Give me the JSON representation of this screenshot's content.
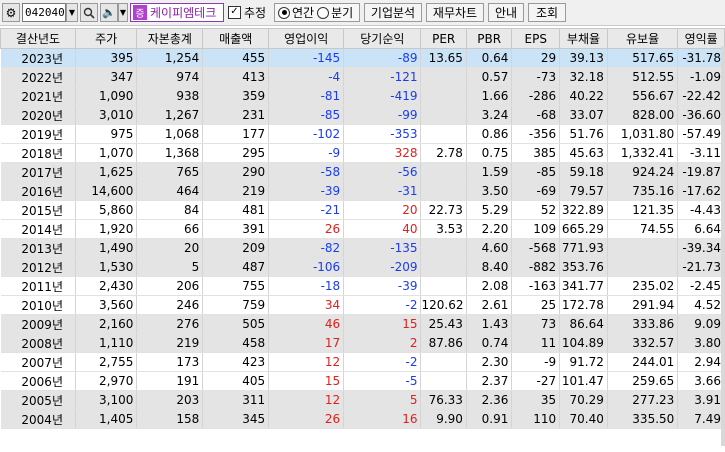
{
  "toolbar": {
    "gear_icon": "gear-icon",
    "code": "042040",
    "search_icon": "magnifier-icon",
    "speaker_icon": "speaker-icon",
    "badge_char": "증",
    "company": "케이피엠테크",
    "trend_label": "추정",
    "trend_checked": true,
    "period_yearly": "연간",
    "period_quarterly": "분기",
    "period_selected": "yearly",
    "btn_company": "기업분석",
    "btn_chart": "재무차트",
    "btn_guide": "안내",
    "btn_query": "조회"
  },
  "table": {
    "columns": [
      "결산년도",
      "주가",
      "자본총계",
      "매출액",
      "영업이익",
      "당기순익",
      "PER",
      "PBR",
      "EPS",
      "부채율",
      "유보율",
      "영익률"
    ],
    "rows": [
      [
        "2023년",
        "395",
        "1,254",
        "455",
        "-145",
        "-89",
        "13.65",
        "0.64",
        "29",
        "39.13",
        "517.65",
        "-31.78"
      ],
      [
        "2022년",
        "347",
        "974",
        "413",
        "-4",
        "-121",
        "",
        "0.57",
        "-73",
        "32.18",
        "512.55",
        "-1.09"
      ],
      [
        "2021년",
        "1,090",
        "938",
        "359",
        "-81",
        "-419",
        "",
        "1.66",
        "-286",
        "40.22",
        "556.67",
        "-22.42"
      ],
      [
        "2020년",
        "3,010",
        "1,267",
        "231",
        "-85",
        "-99",
        "",
        "3.24",
        "-68",
        "33.07",
        "828.00",
        "-36.60"
      ],
      [
        "2019년",
        "975",
        "1,068",
        "177",
        "-102",
        "-353",
        "",
        "0.86",
        "-356",
        "51.76",
        "1,031.80",
        "-57.49"
      ],
      [
        "2018년",
        "1,070",
        "1,368",
        "295",
        "-9",
        "328",
        "2.78",
        "0.75",
        "385",
        "45.63",
        "1,332.41",
        "-3.11"
      ],
      [
        "2017년",
        "1,625",
        "765",
        "290",
        "-58",
        "-56",
        "",
        "1.59",
        "-85",
        "59.18",
        "924.24",
        "-19.87"
      ],
      [
        "2016년",
        "14,600",
        "464",
        "219",
        "-39",
        "-31",
        "",
        "3.50",
        "-69",
        "79.57",
        "735.16",
        "-17.62"
      ],
      [
        "2015년",
        "5,860",
        "84",
        "481",
        "-21",
        "20",
        "22.73",
        "5.29",
        "52",
        "322.89",
        "121.35",
        "-4.43"
      ],
      [
        "2014년",
        "1,920",
        "66",
        "391",
        "26",
        "40",
        "3.53",
        "2.20",
        "109",
        "665.29",
        "74.55",
        "6.64"
      ],
      [
        "2013년",
        "1,490",
        "20",
        "209",
        "-82",
        "-135",
        "",
        "4.60",
        "-568",
        "771.93",
        "",
        "-39.34"
      ],
      [
        "2012년",
        "1,530",
        "5",
        "487",
        "-106",
        "-209",
        "",
        "8.40",
        "-882",
        "353.76",
        "",
        "-21.73"
      ],
      [
        "2011년",
        "2,430",
        "206",
        "755",
        "-18",
        "-39",
        "",
        "2.08",
        "-163",
        "341.77",
        "235.02",
        "-2.45"
      ],
      [
        "2010년",
        "3,560",
        "246",
        "759",
        "34",
        "-2",
        "120.62",
        "2.61",
        "25",
        "172.78",
        "291.94",
        "4.52"
      ],
      [
        "2009년",
        "2,160",
        "276",
        "505",
        "46",
        "15",
        "25.43",
        "1.43",
        "73",
        "86.64",
        "333.86",
        "9.09"
      ],
      [
        "2008년",
        "1,110",
        "219",
        "458",
        "17",
        "2",
        "87.86",
        "0.74",
        "11",
        "104.89",
        "332.57",
        "3.80"
      ],
      [
        "2007년",
        "2,755",
        "173",
        "423",
        "12",
        "-2",
        "",
        "2.30",
        "-9",
        "91.72",
        "244.01",
        "2.94"
      ],
      [
        "2006년",
        "2,970",
        "191",
        "405",
        "15",
        "-5",
        "",
        "2.37",
        "-27",
        "101.47",
        "259.65",
        "3.66"
      ],
      [
        "2005년",
        "3,100",
        "203",
        "311",
        "12",
        "5",
        "76.33",
        "2.36",
        "35",
        "70.29",
        "277.23",
        "3.91"
      ],
      [
        "2004년",
        "1,405",
        "158",
        "345",
        "26",
        "16",
        "9.90",
        "0.91",
        "110",
        "70.40",
        "335.50",
        "7.49"
      ]
    ]
  },
  "colors": {
    "negative": "#1a3cf0",
    "positive": "#e0201c",
    "selected_row": "#cbe3f6"
  }
}
